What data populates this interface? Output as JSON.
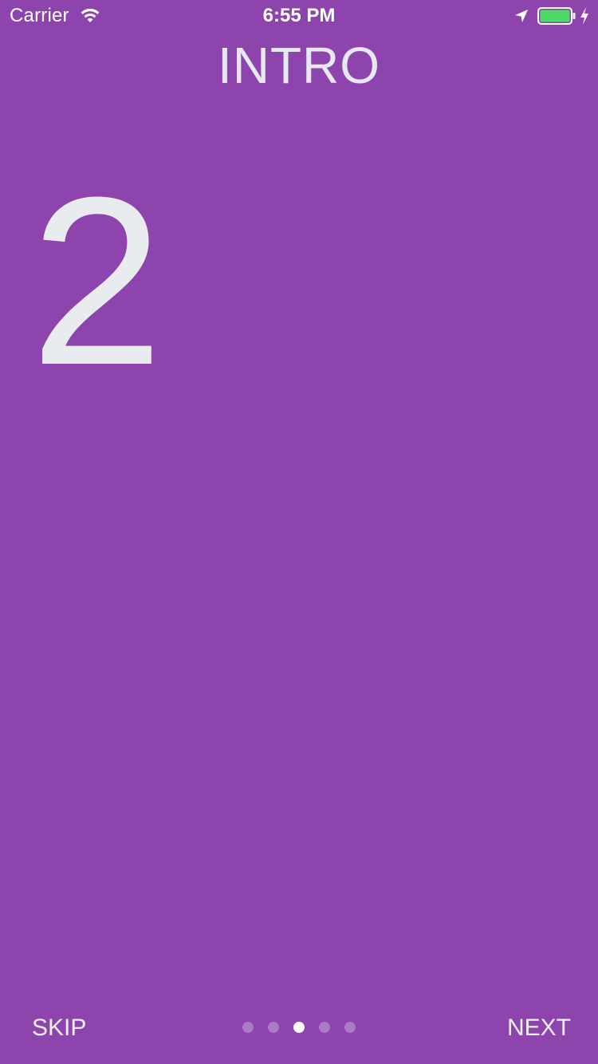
{
  "status_bar": {
    "carrier": "Carrier",
    "time": "6:55 PM",
    "wifi_icon": "wifi-icon",
    "location_icon": "location-arrow-icon",
    "battery_icon": "battery-full-icon",
    "charging_icon": "charging-bolt-icon",
    "battery_color": "#4cd964"
  },
  "header": {
    "title": "INTRO"
  },
  "main": {
    "page_number": "2"
  },
  "footer": {
    "skip_label": "SKIP",
    "next_label": "NEXT",
    "page_count": 5,
    "active_page_index": 2
  },
  "colors": {
    "background": "#8e44ad",
    "text": "#ecf0f1"
  }
}
